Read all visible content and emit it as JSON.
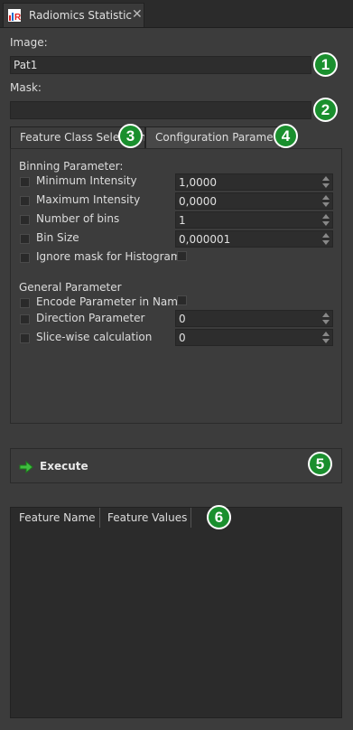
{
  "window": {
    "tab_title": "Radiomics Statistic",
    "close_glyph": "✕",
    "logo_icon": "radiomics-logo-icon"
  },
  "image": {
    "label": "Image:",
    "value": "Pat1"
  },
  "mask": {
    "label": "Mask:",
    "value": ""
  },
  "tabs": [
    {
      "label": "Feature Class Selection",
      "active": true
    },
    {
      "label": "Configuration Parameter",
      "active": false
    }
  ],
  "binning": {
    "title": "Binning Parameter:",
    "rows": [
      {
        "label": "Minimum Intensity",
        "value": "1,0000"
      },
      {
        "label": "Maximum Intensity",
        "value": "0,0000"
      },
      {
        "label": "Number of bins",
        "value": "1"
      },
      {
        "label": "Bin Size",
        "value": "0,000001"
      }
    ],
    "ignore_mask_label": "Ignore mask for Histogram"
  },
  "general": {
    "title": "General Parameter",
    "encode_label": "Encode Parameter in Name",
    "rows": [
      {
        "label": "Direction Parameter",
        "value": "0"
      },
      {
        "label": "Slice-wise calculation",
        "value": "0"
      }
    ]
  },
  "execute": {
    "label": "Execute",
    "icon": "arrow-right-icon"
  },
  "results_table": {
    "columns": [
      "Feature Name",
      "Feature Values"
    ]
  },
  "annotations": [
    "1",
    "2",
    "3",
    "4",
    "5",
    "6"
  ],
  "colors": {
    "badge": "#1a8f2e",
    "background": "#3c3c3c",
    "field": "#2d2d2d"
  }
}
